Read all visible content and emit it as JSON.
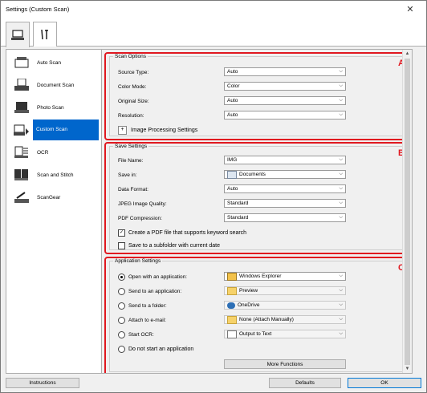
{
  "window": {
    "title": "Settings (Custom Scan)",
    "close_glyph": "✕"
  },
  "tabs": [
    {
      "name": "scan-from-computer",
      "icon": "computer-icon",
      "active": true
    },
    {
      "name": "general-settings",
      "icon": "tools-icon",
      "active": false
    }
  ],
  "sidebar": {
    "items": [
      {
        "label": "Auto Scan",
        "icon": "auto-scan-icon"
      },
      {
        "label": "Document Scan",
        "icon": "document-scan-icon"
      },
      {
        "label": "Photo Scan",
        "icon": "photo-scan-icon"
      },
      {
        "label": "Custom Scan",
        "icon": "custom-scan-icon",
        "selected": true
      },
      {
        "label": "OCR",
        "icon": "ocr-icon"
      },
      {
        "label": "Scan and Stitch",
        "icon": "scan-stitch-icon"
      },
      {
        "label": "ScanGear",
        "icon": "scangear-icon"
      }
    ]
  },
  "scan_options": {
    "title": "Scan Options",
    "marker": "A",
    "source_type": {
      "label": "Source Type:",
      "value": "Auto"
    },
    "color_mode": {
      "label": "Color Mode:",
      "value": "Color"
    },
    "original_size": {
      "label": "Original Size:",
      "value": "Auto"
    },
    "resolution": {
      "label": "Resolution:",
      "value": "Auto"
    },
    "image_processing": {
      "label": "Image Processing Settings",
      "expander": "+"
    }
  },
  "save_settings": {
    "title": "Save Settings",
    "marker": "B",
    "file_name": {
      "label": "File Name:",
      "value": "IMG"
    },
    "save_in": {
      "label": "Save in:",
      "value": "Documents"
    },
    "data_format": {
      "label": "Data Format:",
      "value": "Auto"
    },
    "jpeg_quality": {
      "label": "JPEG Image Quality:",
      "value": "Standard"
    },
    "pdf_compression": {
      "label": "PDF Compression:",
      "value": "Standard"
    },
    "keyword_search": {
      "label": "Create a PDF file that supports keyword search",
      "checked": true
    },
    "subfolder": {
      "label": "Save to a subfolder with current date",
      "checked": false
    }
  },
  "application_settings": {
    "title": "Application Settings",
    "marker": "C",
    "open_with": {
      "label": "Open with an application:",
      "value": "Windows Explorer",
      "selected": true
    },
    "send_to_app": {
      "label": "Send to an application:",
      "value": "Preview"
    },
    "send_to_folder": {
      "label": "Send to a folder:",
      "value": "OneDrive"
    },
    "attach_email": {
      "label": "Attach to e-mail:",
      "value": "None (Attach Manually)"
    },
    "start_ocr": {
      "label": "Start OCR:",
      "value": "Output to Text"
    },
    "do_not_start": {
      "label": "Do not start an application"
    },
    "more_functions": "More Functions"
  },
  "footer": {
    "instructions": "Instructions",
    "defaults": "Defaults",
    "ok": "OK"
  },
  "colors": {
    "accent": "#0066cc",
    "marker": "#e01820"
  }
}
